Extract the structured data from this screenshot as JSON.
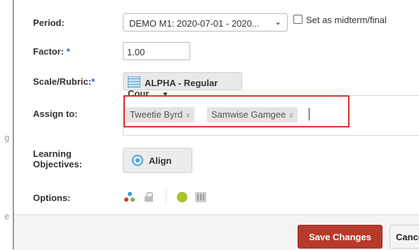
{
  "form": {
    "period": {
      "label": "Period:",
      "selected": "DEMO M1: 2020-07-01 - 2020...",
      "checkbox_label": "Set as midterm/final"
    },
    "factor": {
      "label": "Factor:",
      "required_mark": "*",
      "value": "1.00"
    },
    "scale": {
      "label": "Scale/Rubric:",
      "required_mark": "*",
      "selected": "ALPHA - Regular Cour..."
    },
    "assign_to": {
      "label": "Assign to:",
      "tags": [
        {
          "name": "Tweetie Byrd",
          "remove": "x"
        },
        {
          "name": "Samwise Gamgee",
          "remove": "x"
        }
      ]
    },
    "learning_objectives": {
      "label_line1": "Learning",
      "label_line2": "Objectives:",
      "button": "Align"
    },
    "options": {
      "label": "Options:"
    }
  },
  "footer": {
    "save_label": "Save Changes",
    "cancel_label": "Cancel"
  },
  "background_glyphs": [
    "g",
    "e"
  ],
  "colors": {
    "save_button": "#b73a2b",
    "highlight_box": "#d9342b",
    "required_mark": "#2a64c5",
    "option_green": "#a5c52d",
    "align_icon": "#46a6e0"
  },
  "icons": {
    "scale": "grid-icon",
    "align": "target-icon",
    "options": [
      "colored-dots-icon",
      "lock-icon",
      "green-circle-icon",
      "calendar-icon"
    ]
  }
}
